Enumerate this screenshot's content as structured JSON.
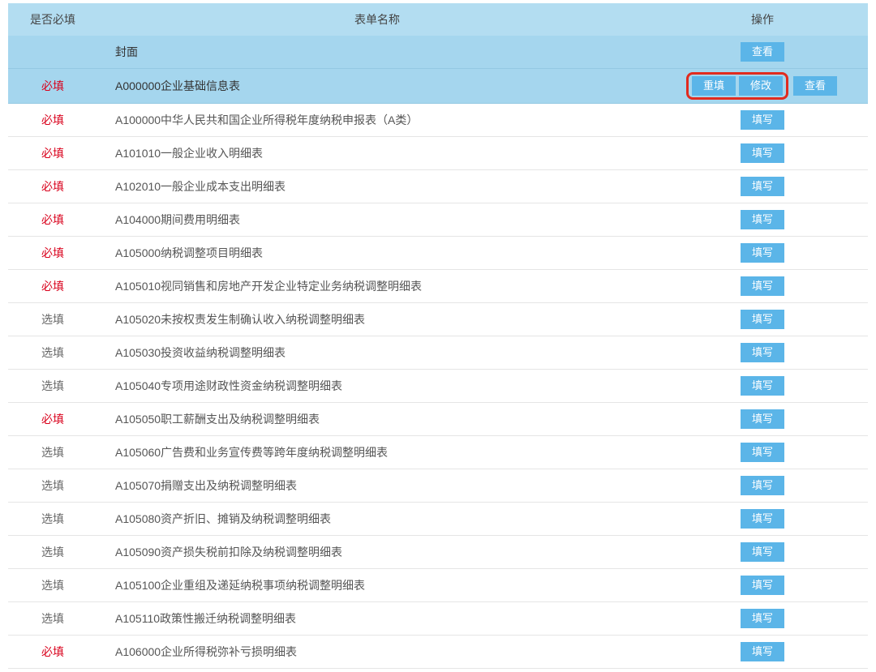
{
  "columns": {
    "required": "是否必填",
    "name": "表单名称",
    "actions": "操作"
  },
  "labels": {
    "required": "必填",
    "optional": "选填"
  },
  "buttons": {
    "view": "查看",
    "refill": "重填",
    "modify": "修改",
    "fill": "填写"
  },
  "rows": [
    {
      "req": "",
      "name": "封面",
      "indent": 1,
      "actions": [
        "view"
      ],
      "highlight": true,
      "redbox": false
    },
    {
      "req": "required",
      "name": "A000000企业基础信息表",
      "indent": 1,
      "actions": [
        "refill",
        "modify",
        "view"
      ],
      "highlight": true,
      "redbox": true
    },
    {
      "req": "required",
      "name": "A100000中华人民共和国企业所得税年度纳税申报表（A类）",
      "indent": 1,
      "actions": [
        "fill"
      ],
      "highlight": false,
      "redbox": false
    },
    {
      "req": "required",
      "name": "A101010一般企业收入明细表",
      "indent": 2,
      "actions": [
        "fill"
      ],
      "highlight": false,
      "redbox": false
    },
    {
      "req": "required",
      "name": "A102010一般企业成本支出明细表",
      "indent": 2,
      "actions": [
        "fill"
      ],
      "highlight": false,
      "redbox": false
    },
    {
      "req": "required",
      "name": "A104000期间费用明细表",
      "indent": 2,
      "actions": [
        "fill"
      ],
      "highlight": false,
      "redbox": false
    },
    {
      "req": "required",
      "name": "A105000纳税调整项目明细表",
      "indent": 2,
      "actions": [
        "fill"
      ],
      "highlight": false,
      "redbox": false
    },
    {
      "req": "required",
      "name": "A105010视同销售和房地产开发企业特定业务纳税调整明细表",
      "indent": 3,
      "actions": [
        "fill"
      ],
      "highlight": false,
      "redbox": false
    },
    {
      "req": "optional",
      "name": "A105020未按权责发生制确认收入纳税调整明细表",
      "indent": 3,
      "actions": [
        "fill"
      ],
      "highlight": false,
      "redbox": false
    },
    {
      "req": "optional",
      "name": "A105030投资收益纳税调整明细表",
      "indent": 3,
      "actions": [
        "fill"
      ],
      "highlight": false,
      "redbox": false
    },
    {
      "req": "optional",
      "name": "A105040专项用途财政性资金纳税调整明细表",
      "indent": 3,
      "actions": [
        "fill"
      ],
      "highlight": false,
      "redbox": false
    },
    {
      "req": "required",
      "name": "A105050职工薪酬支出及纳税调整明细表",
      "indent": 3,
      "actions": [
        "fill"
      ],
      "highlight": false,
      "redbox": false
    },
    {
      "req": "optional",
      "name": "A105060广告费和业务宣传费等跨年度纳税调整明细表",
      "indent": 3,
      "actions": [
        "fill"
      ],
      "highlight": false,
      "redbox": false
    },
    {
      "req": "optional",
      "name": "A105070捐赠支出及纳税调整明细表",
      "indent": 3,
      "actions": [
        "fill"
      ],
      "highlight": false,
      "redbox": false
    },
    {
      "req": "optional",
      "name": "A105080资产折旧、摊销及纳税调整明细表",
      "indent": 3,
      "actions": [
        "fill"
      ],
      "highlight": false,
      "redbox": false
    },
    {
      "req": "optional",
      "name": "A105090资产损失税前扣除及纳税调整明细表",
      "indent": 3,
      "actions": [
        "fill"
      ],
      "highlight": false,
      "redbox": false
    },
    {
      "req": "optional",
      "name": "A105100企业重组及递延纳税事项纳税调整明细表",
      "indent": 3,
      "actions": [
        "fill"
      ],
      "highlight": false,
      "redbox": false
    },
    {
      "req": "optional",
      "name": "A105110政策性搬迁纳税调整明细表",
      "indent": 3,
      "actions": [
        "fill"
      ],
      "highlight": false,
      "redbox": false
    },
    {
      "req": "required",
      "name": "A106000企业所得税弥补亏损明细表",
      "indent": 2,
      "actions": [
        "fill"
      ],
      "highlight": false,
      "redbox": false
    }
  ]
}
